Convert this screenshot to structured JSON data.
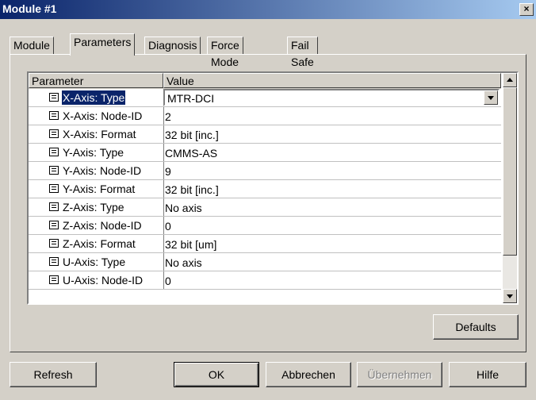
{
  "window": {
    "title": "Module #1",
    "close_label": "×"
  },
  "tabs": [
    {
      "label": "Module",
      "active": false
    },
    {
      "label": "Parameters",
      "active": true
    },
    {
      "label": "Diagnosis",
      "active": false
    },
    {
      "label": "Force Mode",
      "active": false
    },
    {
      "label": "Fail Safe",
      "active": false
    }
  ],
  "grid": {
    "columns": [
      "Parameter",
      "Value"
    ],
    "rows": [
      {
        "parameter": "X-Axis: Type",
        "value": "MTR-DCI",
        "selected": true,
        "editor": "dropdown"
      },
      {
        "parameter": "X-Axis: Node-ID",
        "value": "2"
      },
      {
        "parameter": "X-Axis: Format",
        "value": "32 bit [inc.]"
      },
      {
        "parameter": "Y-Axis: Type",
        "value": "CMMS-AS"
      },
      {
        "parameter": "Y-Axis: Node-ID",
        "value": "9"
      },
      {
        "parameter": "Y-Axis: Format",
        "value": "32 bit [inc.]"
      },
      {
        "parameter": "Z-Axis: Type",
        "value": "No axis"
      },
      {
        "parameter": "Z-Axis: Node-ID",
        "value": "0"
      },
      {
        "parameter": "Z-Axis: Format",
        "value": "32 bit [um]"
      },
      {
        "parameter": "U-Axis: Type",
        "value": "No axis"
      },
      {
        "parameter": "U-Axis: Node-ID",
        "value": "0"
      }
    ]
  },
  "buttons": {
    "defaults": "Defaults",
    "refresh": "Refresh",
    "ok": "OK",
    "cancel": "Abbrechen",
    "apply": "Übernehmen",
    "help": "Hilfe"
  },
  "colors": {
    "title_gradient_start": "#0a246a",
    "title_gradient_end": "#a6caf0",
    "selection": "#0a246a",
    "face": "#d4d0c8"
  }
}
